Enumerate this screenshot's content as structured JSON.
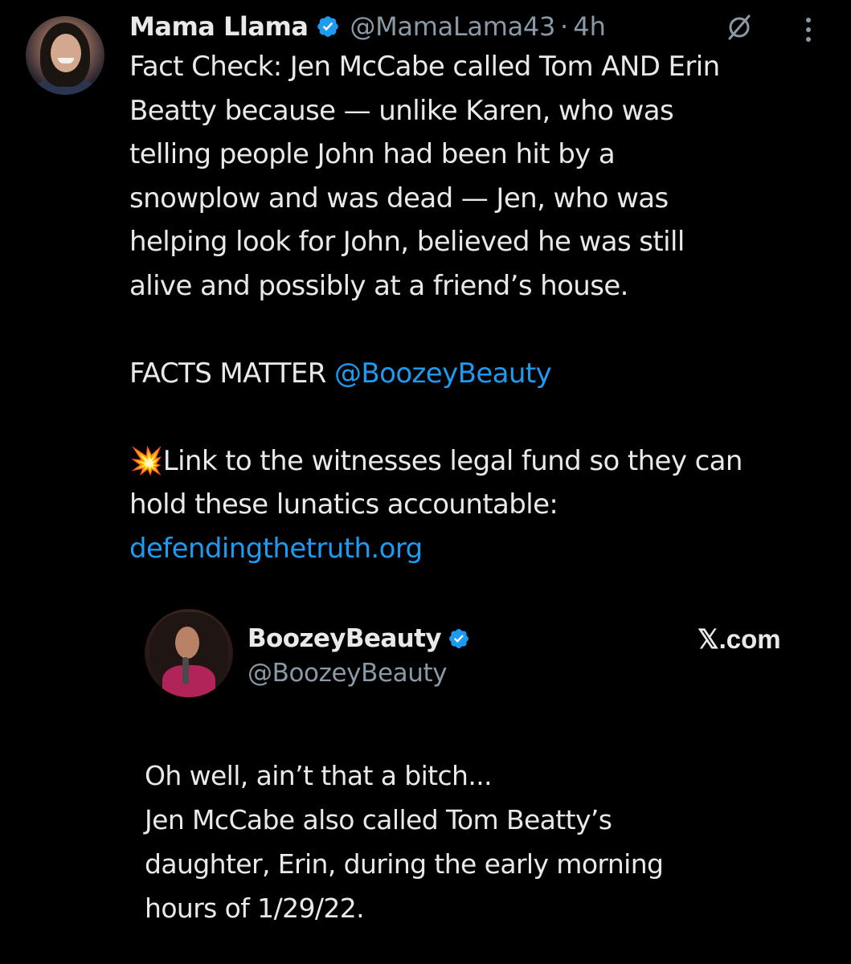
{
  "post": {
    "author": {
      "display_name": "Mama Llama",
      "handle": "@MamaLama43",
      "separator": "·",
      "time": "4h"
    },
    "paragraph_1": "Fact Check: Jen McCabe called Tom AND Erin\nBeatty because — unlike Karen, who was\ntelling people John had been hit by a\nsnowplow and was dead — Jen, who was\nhelping look for John, believed he was still\nalive and possibly at a friend’s house.",
    "paragraph_2_text": "FACTS MATTER ",
    "paragraph_2_mention": "@BoozeyBeauty",
    "paragraph_3_emoji": "💥",
    "paragraph_3_text": "Link to the witnesses legal fund so they can\nhold these lunatics accountable:",
    "paragraph_3_link": "defendingthetruth.org"
  },
  "quoted": {
    "display_name": "BoozeyBeauty",
    "handle": "@BoozeyBeauty",
    "brand": "𝕏.com",
    "text": "Oh well, ain’t that a bitch...\nJen McCabe also called Tom Beatty’s\ndaughter, Erin, during the early morning\nhours of 1/29/22."
  },
  "colors": {
    "background": "#000000",
    "text": "#e7e9ea",
    "secondary": "#8b98a5",
    "accent": "#1d9bf0"
  },
  "icons": [
    "verified-badge-icon",
    "grok-icon",
    "more-options-icon",
    "collision-emoji"
  ]
}
